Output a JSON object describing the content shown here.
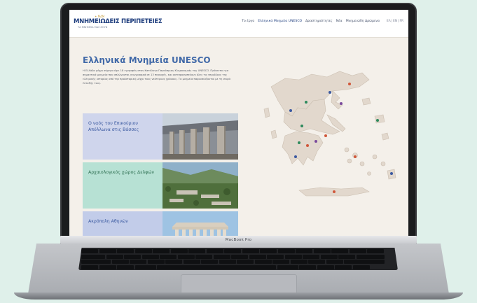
{
  "laptop": {
    "brand": "MacBook Pro"
  },
  "header": {
    "logo_mark": "✦ ΜΔΜ",
    "logo_title": "ΜΝΗΜΕΙΩΔΕΙΣ ΠΕΡΙΠΕΤΕΙΕΣ",
    "logo_subtitle": "ΤΑ ΜΝΗΜΕΙΑ ΜΑΣ ΖΟΥΝ",
    "nav": [
      {
        "label": "Το έργο"
      },
      {
        "label": "Ελληνικά Μνημεία UNESCO"
      },
      {
        "label": "Δραστηριότητες"
      },
      {
        "label": "Νέα"
      },
      {
        "label": "Μνημειώδη Δρώμενα"
      }
    ],
    "languages": [
      "ΕΛ",
      "EN",
      "FR"
    ]
  },
  "main": {
    "title": "Ελληνικά Μνημεία UNESCO",
    "intro": "Η Ελλάδα μέχρι σήμερα έχει 18 εγγραφές στον Κατάλογο Παγκόσμιας Κληρονομιάς της UNESCO. Πρόκειται για σημαντικά μνημεία που απλώνονται γεωγραφικά σε 13 περιοχές, και αντιπροσωπεύουν όλες τις περιόδους της ελληνικής ιστορίας από την προϊστορική μέχρι τους νεότερους χρόνους. Τα μνημεία παρουσιάζονται με τη σειρά ένταξής τους.",
    "cards": [
      {
        "label": "Ο ναός του Επικούριου Απόλλωνα στις Βάσσες"
      },
      {
        "label": "Αρχαιολογικός χώρος Δελφών"
      },
      {
        "label": "Ακρόπολη Αθηνών"
      }
    ]
  },
  "colors": {
    "title": "#4169a8",
    "card1": "#cfd5ec",
    "card2": "#b7e1d4",
    "card3": "#c2cce9",
    "map_land": "#e2d8cd"
  }
}
